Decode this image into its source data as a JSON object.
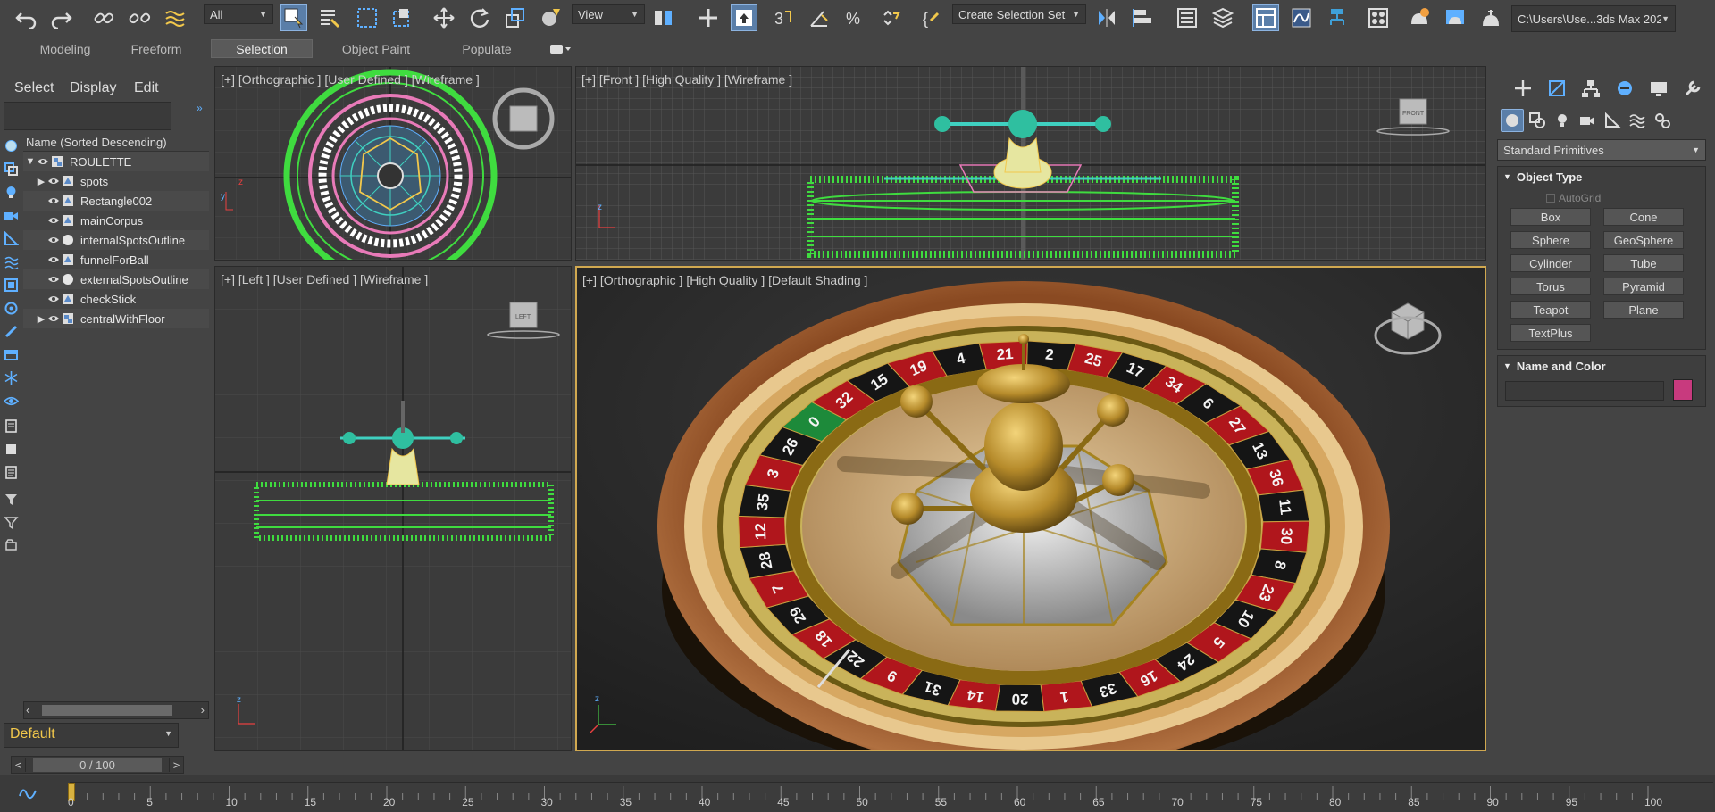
{
  "toolbar": {
    "selection_filter": "All",
    "ref_coord": "View",
    "selection_set": "Create Selection Set",
    "project_path": "C:\\Users\\Use...3ds Max 2023"
  },
  "ribbon": {
    "tabs": [
      "Modeling",
      "Freeform",
      "Selection",
      "Object Paint",
      "Populate"
    ],
    "active_tab": "Selection"
  },
  "scene_explorer": {
    "menu": [
      "Select",
      "Display",
      "Edit"
    ],
    "column_header": "Name (Sorted Descending)",
    "items": [
      {
        "label": "ROULETTE",
        "expander": "▼",
        "indent": 0,
        "icon": "group"
      },
      {
        "label": "spots",
        "expander": "▶",
        "indent": 1,
        "icon": "editable-poly"
      },
      {
        "label": "Rectangle002",
        "expander": "",
        "indent": 1,
        "icon": "editable-poly"
      },
      {
        "label": "mainCorpus",
        "expander": "",
        "indent": 1,
        "icon": "editable-poly"
      },
      {
        "label": "internalSpotsOutline",
        "expander": "",
        "indent": 1,
        "icon": "sphere"
      },
      {
        "label": "funnelForBall",
        "expander": "",
        "indent": 1,
        "icon": "editable-poly"
      },
      {
        "label": "externalSpotsOutline",
        "expander": "",
        "indent": 1,
        "icon": "sphere"
      },
      {
        "label": "checkStick",
        "expander": "",
        "indent": 1,
        "icon": "editable-poly"
      },
      {
        "label": "centralWithFloor",
        "expander": "▶",
        "indent": 1,
        "icon": "group"
      }
    ],
    "layer": "Default"
  },
  "time_slider": {
    "value": "0 / 100",
    "prev": "<",
    "next": ">"
  },
  "viewports": {
    "top_left": "[+] [Orthographic ] [User Defined ] [Wireframe ]",
    "top_right": "[+] [Front ] [High Quality ] [Wireframe ]",
    "bottom_left": "[+] [Left ] [User Defined ] [Wireframe ]",
    "bottom_right": "[+] [Orthographic ] [High Quality ] [Default Shading ]"
  },
  "viewcube": {
    "front": "FRONT",
    "left": "LEFT"
  },
  "command_panel": {
    "category": "Standard Primitives",
    "object_type_title": "Object Type",
    "autogrid": "AutoGrid",
    "buttons": [
      "Box",
      "Cone",
      "Sphere",
      "GeoSphere",
      "Cylinder",
      "Tube",
      "Torus",
      "Pyramid",
      "Teapot",
      "Plane",
      "TextPlus"
    ],
    "name_color_title": "Name and Color",
    "color": "#c83a7e"
  },
  "timeline": {
    "ticks": [
      "0",
      "5",
      "10",
      "15",
      "20",
      "25",
      "30",
      "35",
      "40",
      "45",
      "50",
      "55",
      "60",
      "65",
      "70",
      "75",
      "80",
      "85",
      "90",
      "95",
      "100"
    ]
  },
  "wheel_numbers": [
    "0",
    "32",
    "15",
    "19",
    "4",
    "21",
    "2",
    "25",
    "17",
    "34",
    "6",
    "27",
    "13",
    "36",
    "11",
    "30",
    "8",
    "23",
    "10",
    "5",
    "24",
    "16",
    "33",
    "1",
    "20",
    "14",
    "31",
    "9",
    "22",
    "18",
    "29",
    "7",
    "28",
    "12",
    "35",
    "3",
    "26"
  ],
  "colors": {
    "accent": "#5a7ea8",
    "active_border": "#d0a850",
    "layer_text": "#f2c84b",
    "wire_green": "#3fdc3f",
    "wire_pink": "#e87ab8",
    "wire_cyan": "#3fd0c0"
  }
}
